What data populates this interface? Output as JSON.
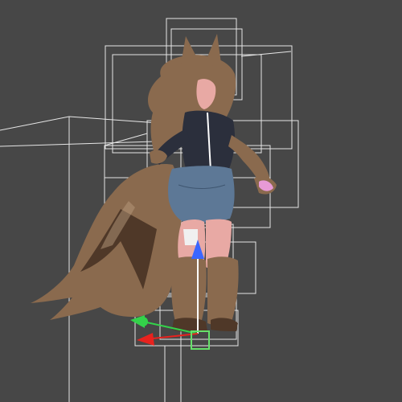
{
  "viewport": {
    "background": "#474747",
    "bounds_color": "#e6e6e6"
  },
  "gizmo": {
    "x_axis_color": "#e8221e",
    "y_axis_color": "#3a66ff",
    "z_axis_color": "#33d24a",
    "center_color": "#66e06a"
  },
  "character": {
    "fur_color": "#8a6a4e",
    "fur_dark_color": "#4f3828",
    "shorts_color": "#5d7896",
    "jacket_color": "#2b2f3c",
    "skin_color": "#e8a9a4",
    "paw_pad_color": "#e79ad6"
  }
}
